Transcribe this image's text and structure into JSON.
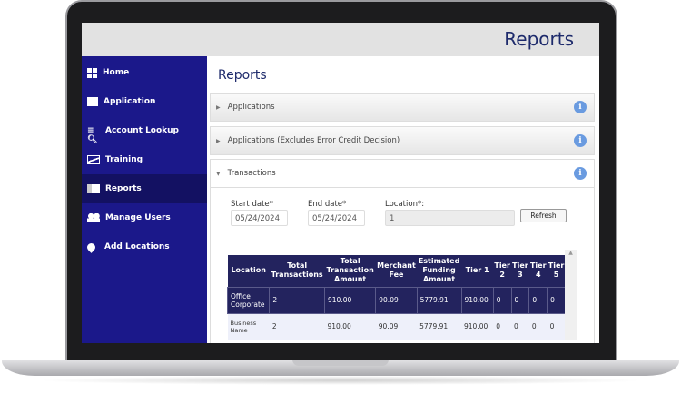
{
  "header": {
    "title": "Reports"
  },
  "sidebar": {
    "items": [
      {
        "label": "Home",
        "icon": "grid-icon"
      },
      {
        "label": "Application",
        "icon": "edit-icon"
      },
      {
        "label": "Account Lookup",
        "icon": "search-list-icon"
      },
      {
        "label": "Training",
        "icon": "chart-icon"
      },
      {
        "label": "Reports",
        "icon": "report-icon",
        "active": true
      },
      {
        "label": "Manage Users",
        "icon": "users-icon"
      },
      {
        "label": "Add Locations",
        "icon": "location-pin-icon"
      }
    ]
  },
  "main": {
    "title": "Reports",
    "sections": [
      {
        "label": "Applications",
        "expanded": false
      },
      {
        "label": "Applications (Excludes Error Credit Decision)",
        "expanded": false
      },
      {
        "label": "Transactions",
        "expanded": true
      }
    ],
    "filters": {
      "start_label": "Start date*",
      "start_value": "05/24/2024",
      "end_label": "End date*",
      "end_value": "05/24/2024",
      "location_label": "Location*:",
      "location_value": "1",
      "refresh_label": "Refresh"
    },
    "table": {
      "headers": [
        "Location",
        "Total Transactions",
        "Total Transaction Amount",
        "Merchant Fee",
        "Estimated Funding Amount",
        "Tier 1",
        "Tier 2",
        "Tier 3",
        "Tier 4",
        "Tier 5"
      ],
      "rows": [
        [
          "Office Corporate",
          "2",
          "910.00",
          "90.09",
          "5779.91",
          "910.00",
          "0",
          "0",
          "0",
          "0"
        ],
        [
          "Business Name",
          "2",
          "910.00",
          "90.09",
          "5779.91",
          "910.00",
          "0",
          "0",
          "0",
          "0"
        ]
      ]
    }
  },
  "colors": {
    "sidebar": "#1b188a",
    "table_header": "#23235e",
    "title": "#1d2a6b",
    "info": "#6a9be0"
  }
}
